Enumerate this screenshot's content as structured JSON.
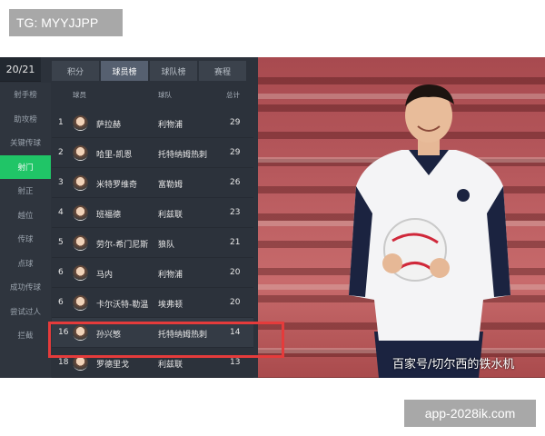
{
  "header": {
    "tg_label": "TG: MYYJJPP"
  },
  "footer": {
    "url_label": "app-2028ik.com"
  },
  "app": {
    "season": "20/21",
    "tabs": [
      {
        "label": "积分"
      },
      {
        "label": "球员榜"
      },
      {
        "label": "球队榜"
      },
      {
        "label": "赛程"
      }
    ],
    "sidebar": [
      {
        "label": "射手榜"
      },
      {
        "label": "助攻榜"
      },
      {
        "label": "关键传球"
      },
      {
        "label": "射门"
      },
      {
        "label": "射正"
      },
      {
        "label": "越位"
      },
      {
        "label": "传球"
      },
      {
        "label": "点球"
      },
      {
        "label": "成功传球"
      },
      {
        "label": "尝试过人"
      },
      {
        "label": "拦截"
      }
    ],
    "table_headers": {
      "player": "球员",
      "team": "球队",
      "total": "总计"
    },
    "rows": [
      {
        "rank": "1",
        "player": "萨拉赫",
        "team": "利物浦",
        "total": "29"
      },
      {
        "rank": "2",
        "player": "哈里-凯恩",
        "team": "托特纳姆热刺",
        "total": "29"
      },
      {
        "rank": "3",
        "player": "米特罗维奇",
        "team": "富勒姆",
        "total": "26"
      },
      {
        "rank": "4",
        "player": "班福德",
        "team": "利兹联",
        "total": "23"
      },
      {
        "rank": "5",
        "player": "劳尔-希门尼斯",
        "team": "狼队",
        "total": "21"
      },
      {
        "rank": "6",
        "player": "马内",
        "team": "利物浦",
        "total": "20"
      },
      {
        "rank": "6",
        "player": "卡尔沃特-勒温",
        "team": "埃弗顿",
        "total": "20"
      },
      {
        "rank": "16",
        "player": "孙兴慜",
        "team": "托特纳姆热刺",
        "total": "14"
      },
      {
        "rank": "18",
        "player": "罗德里戈",
        "team": "利兹联",
        "total": "13"
      }
    ]
  },
  "photo": {
    "watermark": "百家号/切尔西的铁水机"
  },
  "colors": {
    "accent": "#20c567",
    "highlight": "#e53b3b",
    "panel": "#2c323b"
  }
}
